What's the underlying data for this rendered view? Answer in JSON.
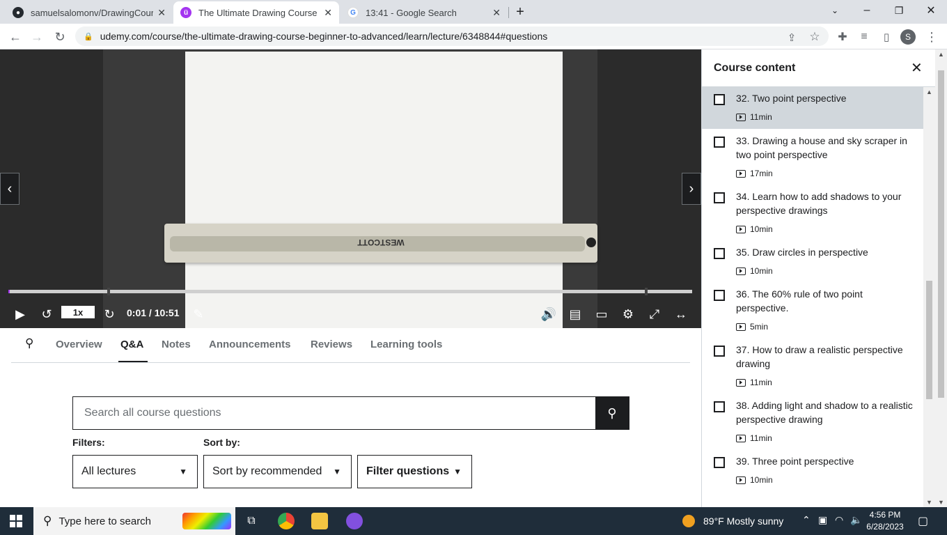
{
  "browser": {
    "tabs": [
      {
        "title": "samuelsalomonv/DrawingCourse",
        "close": "✕",
        "icon": "github-icon"
      },
      {
        "title": "The Ultimate Drawing Course - B",
        "close": "✕",
        "icon": "udemy-icon"
      },
      {
        "title": "13:41 - Google Search",
        "close": "✕",
        "icon": "google-icon"
      }
    ],
    "new_tab": "+",
    "url": "udemy.com/course/the-ultimate-drawing-course-beginner-to-advanced/learn/lecture/6348844#questions",
    "profile_initial": "S"
  },
  "video": {
    "ruler_brand": "WESTCOTT",
    "speed": "1x",
    "time": "0:01 / 10:51",
    "progress_fraction": 0.002
  },
  "page_tabs": [
    "Overview",
    "Q&A",
    "Notes",
    "Announcements",
    "Reviews",
    "Learning tools"
  ],
  "qa": {
    "search_placeholder": "Search all course questions",
    "filters_label": "Filters:",
    "sort_label": "Sort by:",
    "lectures_select": "All lectures",
    "sort_select": "Sort by recommended",
    "filter_questions": "Filter questions"
  },
  "course_content": {
    "title": "Course content",
    "lectures": [
      {
        "title": "32. Two point perspective",
        "duration": "11min",
        "active": true
      },
      {
        "title": "33. Drawing a house and sky scraper in two point perspective",
        "duration": "17min"
      },
      {
        "title": "34. Learn how to add shadows to your perspective drawings",
        "duration": "10min"
      },
      {
        "title": "35. Draw circles in perspective",
        "duration": "10min"
      },
      {
        "title": "36. The 60% rule of two point perspective.",
        "duration": "5min"
      },
      {
        "title": "37. How to draw a realistic perspective drawing",
        "duration": "11min"
      },
      {
        "title": "38. Adding light and shadow to a realistic perspective drawing",
        "duration": "11min"
      },
      {
        "title": "39. Three point perspective",
        "duration": "10min"
      }
    ]
  },
  "taskbar": {
    "search_text": "Type here to search",
    "weather": "89°F  Mostly sunny",
    "time": "4:56 PM",
    "date": "6/28/2023"
  },
  "colors": {
    "udemy_purple": "#a435f0",
    "text_dark": "#1c1d1f",
    "taskbar": "#1f2d3a"
  }
}
